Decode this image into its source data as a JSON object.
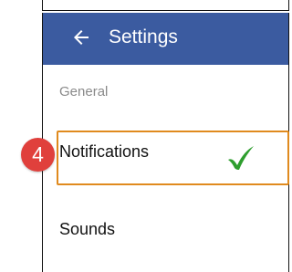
{
  "appbar": {
    "title": "Settings",
    "back_icon": "arrow-left-icon",
    "background_color": "#3b5ba0"
  },
  "settings": {
    "section_header": "General",
    "items": [
      {
        "label": "Notifications",
        "status_icon": "checkmark-icon"
      },
      {
        "label": "Sounds"
      }
    ]
  },
  "annotation": {
    "step_number": "4",
    "badge_color": "#e0403c",
    "highlight_color": "#e08a1e",
    "check_color": "#2e9e2e"
  }
}
